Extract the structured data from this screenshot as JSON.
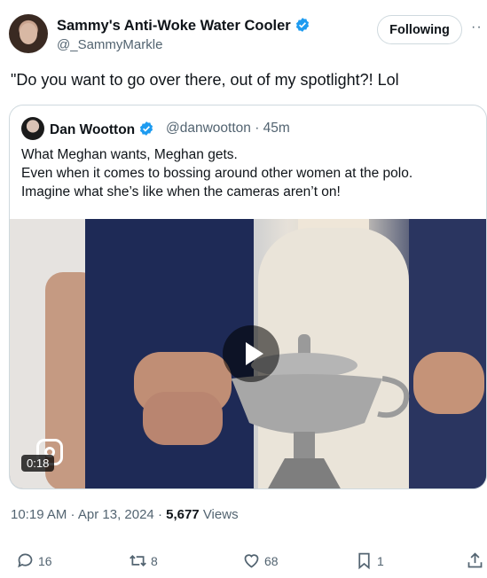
{
  "author": {
    "name": "Sammy's Anti-Woke Water Cooler",
    "handle": "@_SammyMarkle",
    "verified_icon": "verified-badge-icon"
  },
  "follow_button": {
    "label": "Following"
  },
  "more_label": "··",
  "tweet_text": "\"Do you want to go over there, out of my spotlight?! Lol",
  "quote": {
    "name": "Dan Wootton",
    "handle_time": "@danwootton · 45m",
    "lines": [
      "What Meghan wants, Meghan gets.",
      "Even when it comes to bossing around other women at the polo.",
      "Imagine what she’s like when the cameras aren’t on!"
    ],
    "video": {
      "duration": "0:18"
    }
  },
  "meta": {
    "time_date": "10:19 AM · Apr 13, 2024 · ",
    "views_count": "5,677",
    "views_label": " Views"
  },
  "actions": {
    "replies": "16",
    "reposts": "8",
    "likes": "68",
    "bookmarks": "1"
  },
  "colors": {
    "verified": "#1d9bf0",
    "secondary_text": "#536471",
    "border": "#cfd9de"
  }
}
